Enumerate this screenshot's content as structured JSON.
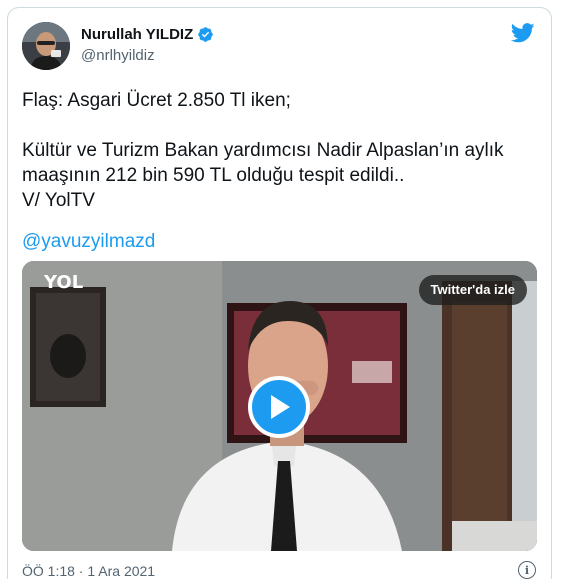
{
  "author": {
    "display_name": "Nurullah YILDIZ",
    "handle": "@nrlhyildiz"
  },
  "tweet": {
    "lines": [
      "Flaş: Asgari Ücret 2.850 Tl iken;",
      "Kültür ve Turizm Bakan yardımcısı Nadir Alpaslan’ın aylık",
      "maaşının 212 bin 590 TL olduğu tespit edildi..",
      "V/ YolTV"
    ],
    "mention": "@yavuzyilmazd"
  },
  "video": {
    "watch_label": "Twitter'da izle",
    "channel_logo": "YOL"
  },
  "footer": {
    "timestamp": "ÖÖ 1:18 · 1 Ara 2021",
    "info_glyph": "i"
  },
  "colors": {
    "accent": "#1d9bf0",
    "text": "#0f1419",
    "secondary": "#536471",
    "border": "#cfd9de"
  },
  "icons": [
    "verified-badge-icon",
    "twitter-bird-icon",
    "play-icon",
    "info-icon"
  ]
}
